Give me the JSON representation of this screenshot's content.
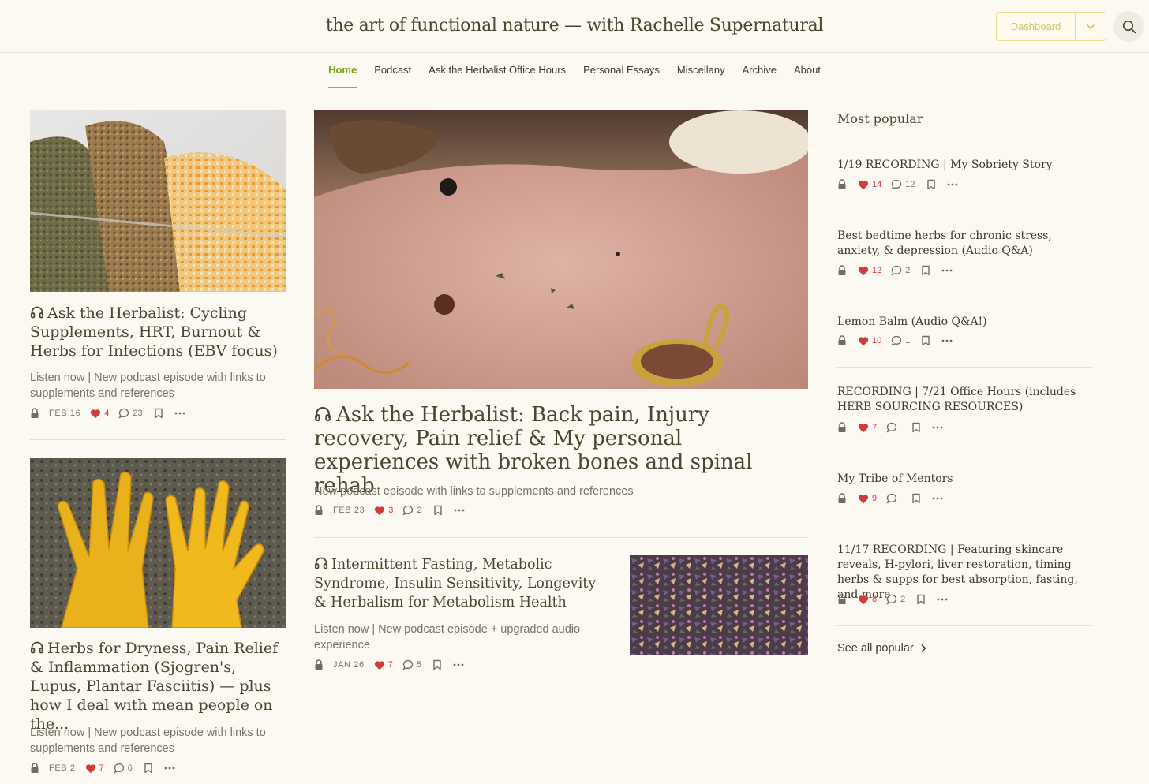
{
  "site": {
    "title": "the art of functional nature — with Rachelle Supernatural"
  },
  "header": {
    "dashboard_label": "Dashboard"
  },
  "nav": {
    "items": [
      "Home",
      "Podcast",
      "Ask the Herbalist Office Hours",
      "Personal Essays",
      "Miscellany",
      "Archive",
      "About"
    ],
    "active": "Home"
  },
  "posts": {
    "left_top": {
      "title": "Ask the Herbalist: Cycling Supplements, HRT, Burnout & Herbs for Infections (EBV focus)",
      "subtitle": "Listen now | New podcast episode with links to supplements and references",
      "date": "FEB 16",
      "likes": "4",
      "comments": "23"
    },
    "left_bottom": {
      "title": "Herbs for Dryness, Pain Relief & Inflammation (Sjogren's, Lupus, Plantar Fasciitis) — plus how I deal with mean people on the...",
      "subtitle": "Listen now | New podcast episode with links to supplements and references",
      "date": "FEB 2",
      "likes": "7",
      "comments": "6"
    },
    "featured": {
      "title": "Ask the Herbalist: Back pain, Injury recovery, Pain relief & My personal experiences with broken bones and spinal rehab",
      "subtitle": "New podcast episode with links to supplements and references",
      "date": "FEB 23",
      "likes": "3",
      "comments": "2"
    },
    "secondary": {
      "title": "Intermittent Fasting, Metabolic Syndrome, Insulin Sensitivity, Longevity & Herbalism for Metabolism Health",
      "subtitle": "Listen now | New podcast episode + upgraded audio experience",
      "date": "JAN 26",
      "likes": "7",
      "comments": "5"
    }
  },
  "popular": {
    "heading": "Most popular",
    "items": [
      {
        "title": "1/19 RECORDING | My Sobriety Story",
        "likes": "14",
        "comments": "12"
      },
      {
        "title": "Best bedtime herbs for chronic stress, anxiety, & depression (Audio Q&A)",
        "likes": "12",
        "comments": "2"
      },
      {
        "title": "Lemon Balm (Audio Q&A!)",
        "likes": "10",
        "comments": "1"
      },
      {
        "title": "RECORDING | 7/21 Office Hours (includes HERB SOURCING RESOURCES)",
        "likes": "7",
        "comments": ""
      },
      {
        "title": "My Tribe of Mentors",
        "likes": "9",
        "comments": ""
      },
      {
        "title": "11/17 RECORDING | Featuring skincare reveals, H-pylori, liver restoration, timing herbs & supps for best absorption, fasting, and more",
        "likes": "8",
        "comments": "2"
      }
    ],
    "see_all": "See all popular"
  },
  "icons": {
    "headphones": "headphones-icon",
    "lock": "lock-icon",
    "heart": "heart-icon",
    "comment": "comment-icon",
    "bookmark": "bookmark-icon",
    "more": "more-icon",
    "search": "search-icon",
    "chevron": "chevron-down-icon"
  },
  "colors": {
    "accent": "#8fb32c",
    "heart": "#d13b3b",
    "background": "#fcf9f2",
    "dashboard": "#ecdf90"
  }
}
